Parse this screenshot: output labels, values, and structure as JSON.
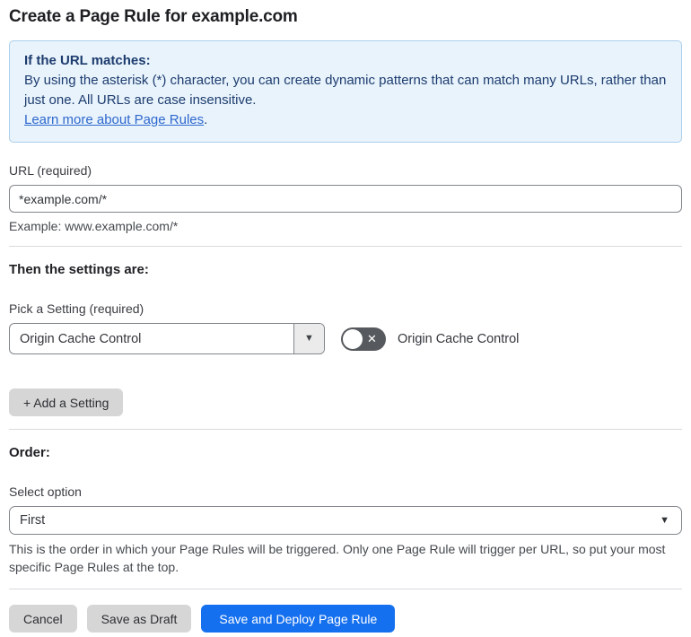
{
  "page": {
    "title": "Create a Page Rule for example.com"
  },
  "info_box": {
    "heading": "If the URL matches:",
    "body": "By using the asterisk (*) character, you can create dynamic patterns that can match many URLs, rather than just one. All URLs are case insensitive.",
    "link_label": "Learn more about Page Rules",
    "link_suffix": "."
  },
  "url_field": {
    "label": "URL (required)",
    "value": "*example.com/*",
    "helper": "Example: www.example.com/*"
  },
  "settings_section": {
    "heading": "Then the settings are:",
    "picker_label": "Pick a Setting (required)",
    "picker_value": "Origin Cache Control",
    "toggle_label": "Origin Cache Control",
    "toggle_state": "off",
    "add_button_label": "+ Add a Setting"
  },
  "order_section": {
    "heading": "Order:",
    "select_label": "Select option",
    "select_value": "First",
    "helper": "This is the order in which your Page Rules will be triggered. Only one Page Rule will trigger per URL, so put your most specific Page Rules at the top."
  },
  "footer": {
    "cancel_label": "Cancel",
    "save_draft_label": "Save as Draft",
    "save_deploy_label": "Save and Deploy Page Rule"
  },
  "icons": {
    "dropdown_caret": "▼",
    "toggle_off_x": "✕"
  },
  "colors": {
    "accent_blue": "#1570ef",
    "info_box_background": "#e8f3fc",
    "info_box_border": "#abcfec",
    "info_text": "#1d3c6e",
    "link_blue": "#2e68cd",
    "toggle_off_background": "#56595d",
    "gray_button_background": "#d6d6d6"
  }
}
